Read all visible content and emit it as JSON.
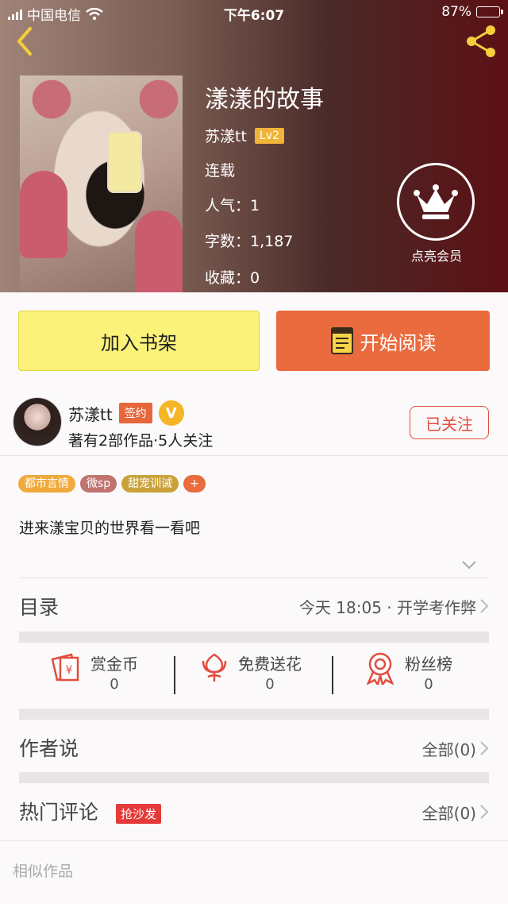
{
  "status_bar": {
    "carrier": "中国电信",
    "time": "下午6:07",
    "battery": "87%"
  },
  "book": {
    "title": "漾漾的故事",
    "author": "苏漾tt",
    "level": "Lv2",
    "status": "连载",
    "popularity": "人气：1",
    "word_count": "字数：1,187",
    "favorites": "收藏：0"
  },
  "vip": {
    "label": "点亮会员"
  },
  "actions": {
    "add_shelf": "加入书架",
    "start_read": "开始阅读"
  },
  "author": {
    "name": "苏漾tt",
    "sign_badge": "签约",
    "v_badge": "V",
    "summary": "著有2部作品·5人关注",
    "follow": "已关注"
  },
  "tags": [
    {
      "label": "都市言情",
      "color": "#f0a93c"
    },
    {
      "label": "微sp",
      "color": "#c1736e"
    },
    {
      "label": "甜宠训诫",
      "color": "#c9a23a"
    },
    {
      "label": "+",
      "color": "#ea6b3e"
    }
  ],
  "synopsis": "进来漾宝贝的世界看一看吧",
  "toc": {
    "title": "目录",
    "latest": "今天 18:05 · 开学考作弊"
  },
  "stats": [
    {
      "label": "赏金币",
      "value": "0",
      "icon": "coin-envelope-icon"
    },
    {
      "label": "免费送花",
      "value": "0",
      "icon": "flower-icon"
    },
    {
      "label": "粉丝榜",
      "value": "0",
      "icon": "ribbon-medal-icon"
    }
  ],
  "author_says": {
    "title": "作者说",
    "all": "全部(0)"
  },
  "hot_comments": {
    "title": "热门评论",
    "badge": "抢沙发",
    "all": "全部(0)"
  },
  "similar": {
    "title": "相似作品"
  },
  "colors": {
    "accent": "#ea6b3e",
    "shelf": "#fbf27a",
    "follow": "#e24d3f"
  }
}
